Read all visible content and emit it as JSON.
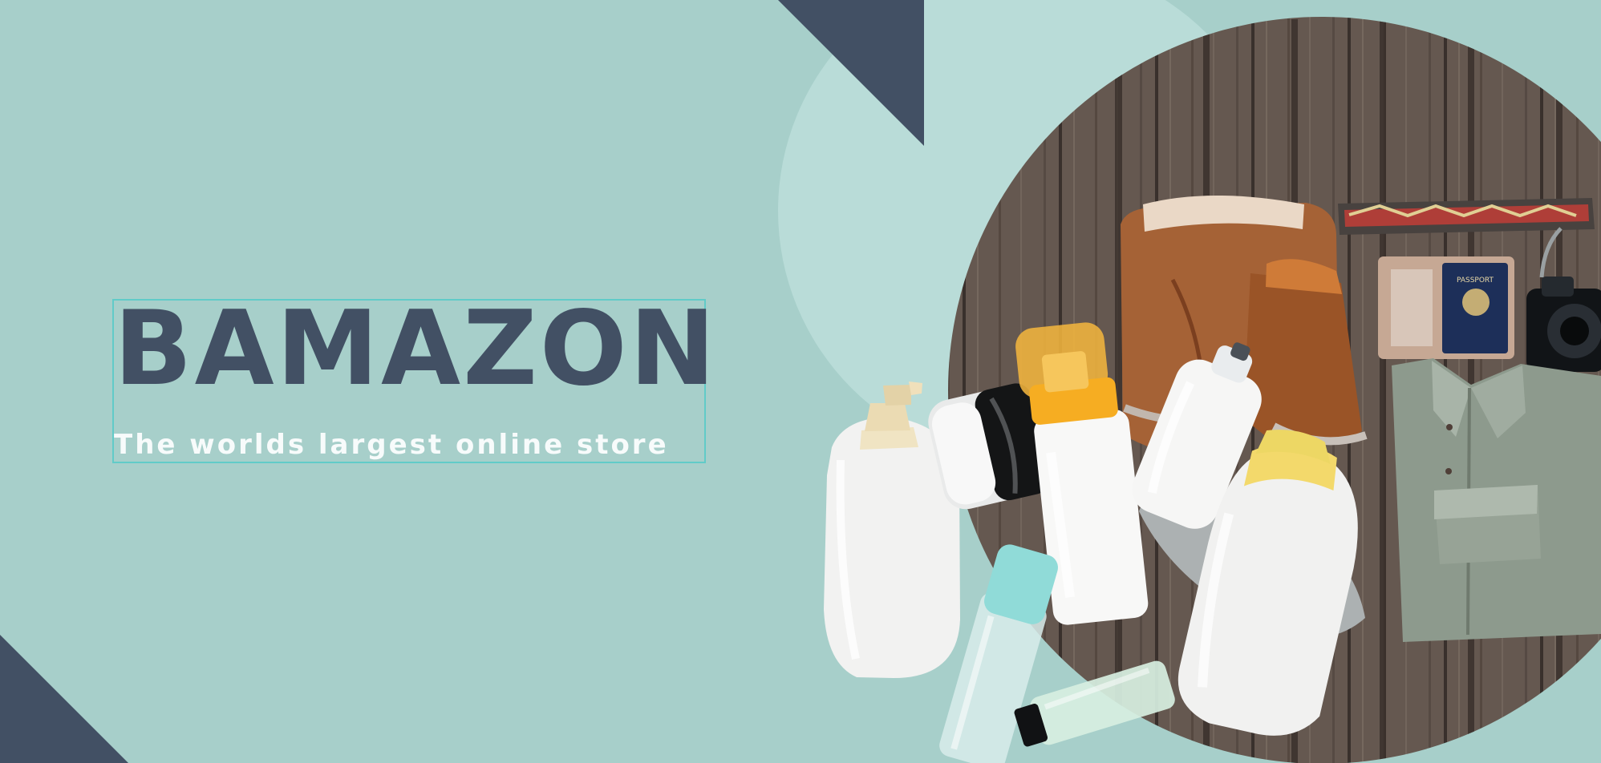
{
  "hero": {
    "brand_title": "BAMAZON",
    "tagline": "The worlds largest online store"
  },
  "product_image": {
    "description_icon": "product-collage-icon",
    "items": [
      "boots-icon",
      "camera-strap-icon",
      "passport-icon",
      "camera-icon",
      "shirt-icon",
      "pump-bottle-icon",
      "cream-jar-icon",
      "foam-bottle-icon",
      "spray-bottle-icon",
      "lotion-bottle-icon",
      "clear-bottle-icon",
      "tube-icon"
    ],
    "passport_label": "PASSPORT"
  },
  "colors": {
    "background": "#a7cfca",
    "light_circle": "#b9dcd8",
    "dark_shape": "#425064",
    "title": "#425064",
    "tagline": "#f7fbfb",
    "outline": "#61cbc8"
  }
}
